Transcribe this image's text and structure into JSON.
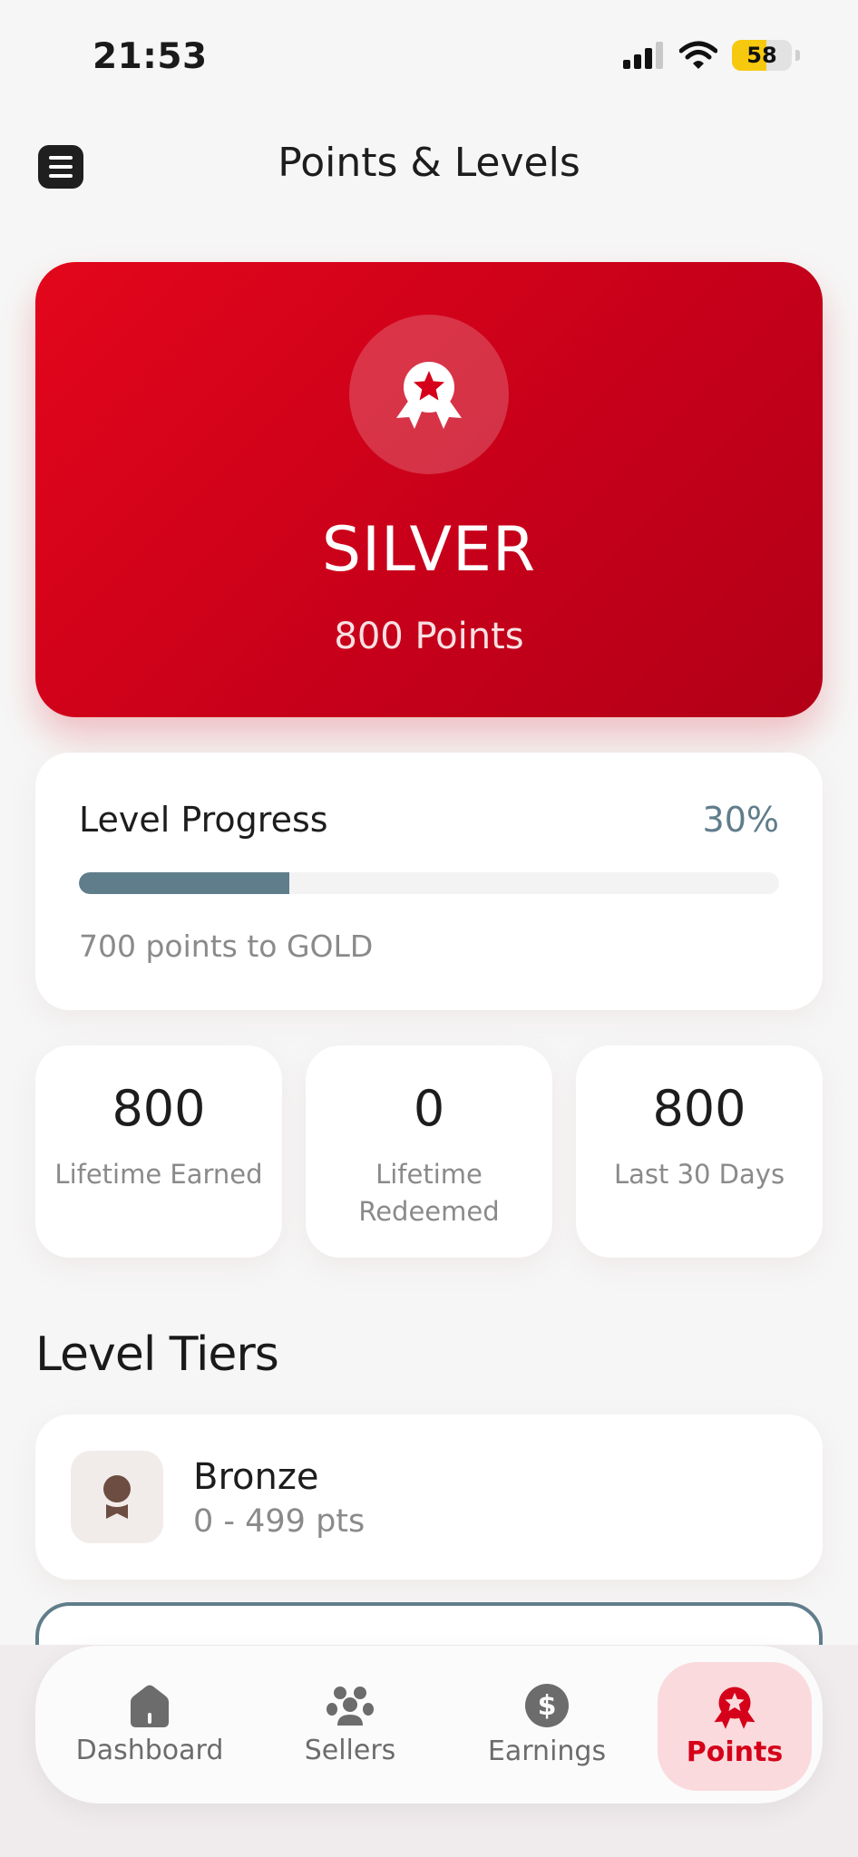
{
  "status_bar": {
    "time": "21:53",
    "battery": "58",
    "battery_level": 0.58
  },
  "header": {
    "title": "Points & Levels"
  },
  "level_card": {
    "level": "SILVER",
    "points": "800 Points"
  },
  "progress": {
    "title": "Level Progress",
    "percent_label": "30%",
    "fraction": 0.3,
    "hint": "700 points to GOLD"
  },
  "stats": [
    {
      "value": "800",
      "label": "Lifetime Earned"
    },
    {
      "value": "0",
      "label": "Lifetime Redeemed"
    },
    {
      "value": "800",
      "label": "Last 30 Days"
    }
  ],
  "tiers_section": {
    "title": "Level Tiers",
    "tiers": [
      {
        "name": "Bronze",
        "range": "0 - 499 pts"
      }
    ]
  },
  "tabbar": {
    "items": [
      {
        "label": "Dashboard",
        "icon": "home-icon"
      },
      {
        "label": "Sellers",
        "icon": "users-icon"
      },
      {
        "label": "Earnings",
        "icon": "dollar-icon"
      },
      {
        "label": "Points",
        "icon": "award-icon",
        "active": true
      }
    ]
  },
  "colors": {
    "brand_red": "#d50019",
    "accent_slate": "#607d8b",
    "bronze": "#6d4c41",
    "active_tab_bg": "#fadadd"
  }
}
